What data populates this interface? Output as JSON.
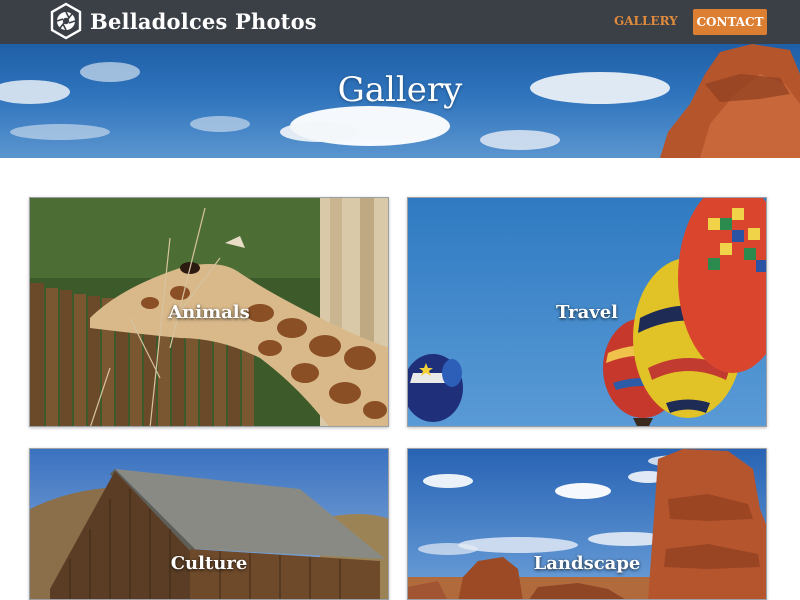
{
  "header": {
    "brand": "Belladolces Photos",
    "nav": [
      {
        "label": "GALLERY",
        "active": true
      },
      {
        "label": "CONTACT",
        "style": "button"
      }
    ]
  },
  "hero": {
    "title": "Gallery"
  },
  "tiles": [
    {
      "label": "Animals"
    },
    {
      "label": "Travel"
    },
    {
      "label": "Culture"
    },
    {
      "label": "Landscape"
    }
  ],
  "colors": {
    "nav_bg": "#3b4047",
    "accent": "#dd7f32",
    "nav_active_text": "#e08a3c"
  }
}
